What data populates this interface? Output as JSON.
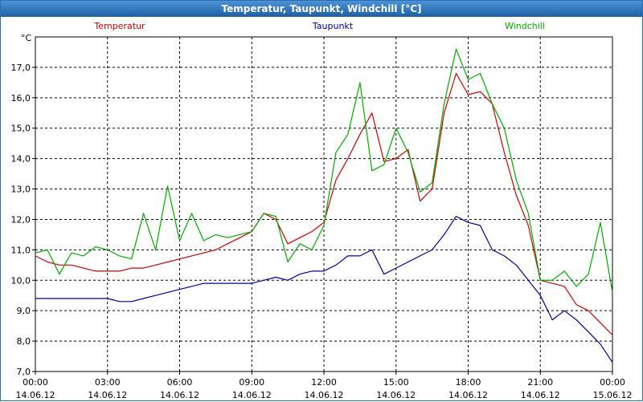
{
  "window": {
    "title": "Temperatur, Taupunkt, Windchill [°C]"
  },
  "chart_data": {
    "type": "line",
    "title": "Temperatur, Taupunkt, Windchill [°C]",
    "ylabel": "°C",
    "ylim": [
      7.0,
      18.0
    ],
    "xlim": [
      0,
      24
    ],
    "grid": true,
    "legend_position": "top",
    "y_ticks": [
      "7,0",
      "8,0",
      "9,0",
      "10,0",
      "11,0",
      "12,0",
      "13,0",
      "14,0",
      "15,0",
      "16,0",
      "17,0"
    ],
    "x_ticks": [
      {
        "time": "00:00",
        "date": "14.06.12"
      },
      {
        "time": "03:00",
        "date": "14.06.12"
      },
      {
        "time": "06:00",
        "date": "14.06.12"
      },
      {
        "time": "09:00",
        "date": "14.06.12"
      },
      {
        "time": "12:00",
        "date": "14.06.12"
      },
      {
        "time": "15:00",
        "date": "14.06.12"
      },
      {
        "time": "18:00",
        "date": "14.06.12"
      },
      {
        "time": "21:00",
        "date": "14.06.12"
      },
      {
        "time": "00:00",
        "date": "15.06.12"
      }
    ],
    "x_unit": "hours since 14.06.12 00:00",
    "series": [
      {
        "name": "Temperatur",
        "color": "#cc0000",
        "x": [
          0,
          0.5,
          1,
          1.5,
          2,
          2.5,
          3,
          3.5,
          4,
          4.5,
          5,
          5.5,
          6,
          6.5,
          7,
          7.5,
          8,
          8.5,
          9,
          9.5,
          10,
          10.5,
          11,
          11.5,
          12,
          12.5,
          13,
          13.5,
          14,
          14.5,
          15,
          15.5,
          16,
          16.5,
          17,
          17.5,
          18,
          18.5,
          19,
          19.5,
          20,
          20.5,
          21,
          21.5,
          22,
          22.5,
          23,
          23.5,
          24
        ],
        "values": [
          10.8,
          10.6,
          10.5,
          10.5,
          10.4,
          10.3,
          10.3,
          10.3,
          10.4,
          10.4,
          10.5,
          10.6,
          10.7,
          10.8,
          10.9,
          11.0,
          11.2,
          11.4,
          11.6,
          12.2,
          12.0,
          11.2,
          11.4,
          11.6,
          11.9,
          13.3,
          14.0,
          14.8,
          15.5,
          13.9,
          14.0,
          14.3,
          12.6,
          13.0,
          15.5,
          16.8,
          16.1,
          16.2,
          15.8,
          14.2,
          12.8,
          11.8,
          10.0,
          9.9,
          9.8,
          9.2,
          9.0,
          8.6,
          8.2
        ]
      },
      {
        "name": "Taupunkt",
        "color": "#000099",
        "x": [
          0,
          0.5,
          1,
          1.5,
          2,
          2.5,
          3,
          3.5,
          4,
          4.5,
          5,
          5.5,
          6,
          6.5,
          7,
          7.5,
          8,
          8.5,
          9,
          9.5,
          10,
          10.5,
          11,
          11.5,
          12,
          12.5,
          13,
          13.5,
          14,
          14.5,
          15,
          15.5,
          16,
          16.5,
          17,
          17.5,
          18,
          18.5,
          19,
          19.5,
          20,
          20.5,
          21,
          21.5,
          22,
          22.5,
          23,
          23.5,
          24
        ],
        "values": [
          9.4,
          9.4,
          9.4,
          9.4,
          9.4,
          9.4,
          9.4,
          9.3,
          9.3,
          9.4,
          9.5,
          9.6,
          9.7,
          9.8,
          9.9,
          9.9,
          9.9,
          9.9,
          9.9,
          10.0,
          10.1,
          10.0,
          10.2,
          10.3,
          10.3,
          10.5,
          10.8,
          10.8,
          11.0,
          10.2,
          10.4,
          10.6,
          10.8,
          11.0,
          11.5,
          12.1,
          11.9,
          11.8,
          11.0,
          10.8,
          10.5,
          10.0,
          9.5,
          8.7,
          9.0,
          8.7,
          8.3,
          7.9,
          7.3
        ]
      },
      {
        "name": "Windchill",
        "color": "#00aa00",
        "x": [
          0,
          0.5,
          1,
          1.5,
          2,
          2.5,
          3,
          3.5,
          4,
          4.5,
          5,
          5.5,
          6,
          6.5,
          7,
          7.5,
          8,
          8.5,
          9,
          9.5,
          10,
          10.5,
          11,
          11.5,
          12,
          12.5,
          13,
          13.5,
          14,
          14.5,
          15,
          15.5,
          16,
          16.5,
          17,
          17.5,
          18,
          18.5,
          19,
          19.5,
          20,
          20.5,
          21,
          21.5,
          22,
          22.5,
          23,
          23.5,
          24
        ],
        "values": [
          10.9,
          11.0,
          10.2,
          10.9,
          10.8,
          11.1,
          11.0,
          10.8,
          10.7,
          12.2,
          11.0,
          13.1,
          11.3,
          12.2,
          11.3,
          11.5,
          11.4,
          11.5,
          11.6,
          12.2,
          12.1,
          10.6,
          11.2,
          11.0,
          11.8,
          14.2,
          14.8,
          16.5,
          13.6,
          13.8,
          15.0,
          14.2,
          12.9,
          13.2,
          15.8,
          17.6,
          16.6,
          16.8,
          15.8,
          15.0,
          13.3,
          12.2,
          10.0,
          10.0,
          10.3,
          9.8,
          10.2,
          11.9,
          9.6
        ]
      }
    ]
  }
}
